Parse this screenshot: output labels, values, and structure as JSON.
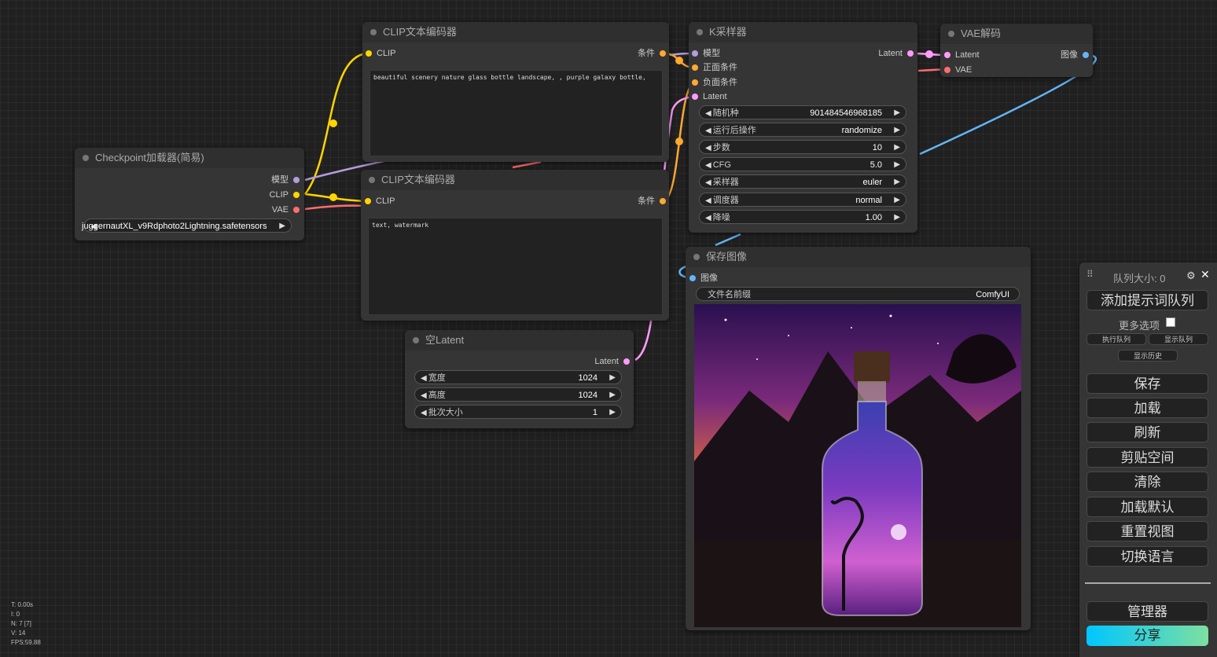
{
  "colors": {
    "model": "#b39ddb",
    "clip": "#ffd500",
    "vae": "#ff6e6e",
    "conditioning": "#ffa931",
    "latent": "#ff9cf9",
    "image": "#64b5f6"
  },
  "checkpoint": {
    "title": "Checkpoint加载器(简易)",
    "out_model": "模型",
    "out_clip": "CLIP",
    "out_vae": "VAE",
    "ckpt_value": "juggernautXL_v9Rdphoto2Lightning.safetensors"
  },
  "clip_pos": {
    "title": "CLIP文本编码器",
    "in_clip": "CLIP",
    "out_cond": "条件",
    "text": "beautiful scenery nature glass bottle landscape, , purple galaxy bottle,"
  },
  "clip_neg": {
    "title": "CLIP文本编码器",
    "in_clip": "CLIP",
    "out_cond": "条件",
    "text": "text, watermark"
  },
  "ksampler": {
    "title": "K采样器",
    "in_model": "模型",
    "in_positive": "正面条件",
    "in_negative": "负面条件",
    "in_latent": "Latent",
    "out_latent": "Latent",
    "widgets": [
      {
        "label": "随机种",
        "value": "901484546968185"
      },
      {
        "label": "运行后操作",
        "value": "randomize"
      },
      {
        "label": "步数",
        "value": "10"
      },
      {
        "label": "CFG",
        "value": "5.0"
      },
      {
        "label": "采样器",
        "value": "euler"
      },
      {
        "label": "调度器",
        "value": "normal"
      },
      {
        "label": "降噪",
        "value": "1.00"
      }
    ]
  },
  "vae_decode": {
    "title": "VAE解码",
    "in_latent": "Latent",
    "in_vae": "VAE",
    "out_image": "图像"
  },
  "empty_latent": {
    "title": "空Latent",
    "out_latent": "Latent",
    "widgets": [
      {
        "label": "宽度",
        "value": "1024"
      },
      {
        "label": "高度",
        "value": "1024"
      },
      {
        "label": "批次大小",
        "value": "1"
      }
    ]
  },
  "save_image": {
    "title": "保存图像",
    "in_image": "图像",
    "prefix_label": "文件名前缀",
    "prefix_value": "ComfyUI"
  },
  "menu": {
    "queue_size": "队列大小: 0",
    "queue_prompt": "添加提示词队列",
    "extra_options": "更多选项",
    "view_queue": "执行队列",
    "show_queue": "显示队列",
    "view_history": "显示历史",
    "save": "保存",
    "load": "加载",
    "refresh": "刷新",
    "clipspace": "剪贴空间",
    "clear": "清除",
    "load_default": "加载默认",
    "reset_view": "重置视图",
    "switch_lang": "切换语言",
    "manager": "管理器",
    "share": "分享"
  },
  "stats": {
    "t": "T: 0.00s",
    "i": "I: 0",
    "n": "N: 7 [7]",
    "v": "V: 14",
    "fps": "FPS:59.88"
  }
}
